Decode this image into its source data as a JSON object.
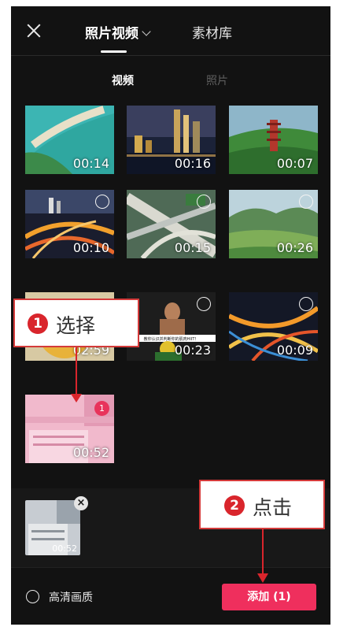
{
  "header": {
    "tab_photos_videos": "照片视频",
    "tab_library": "素材库"
  },
  "subtabs": {
    "video": "视频",
    "photo": "照片"
  },
  "grid": {
    "tiles": [
      {
        "duration": "00:14",
        "state": "none"
      },
      {
        "duration": "00:16",
        "state": "none"
      },
      {
        "duration": "00:07",
        "state": "none"
      },
      {
        "duration": "00:10",
        "state": "ring"
      },
      {
        "duration": "00:15",
        "state": "ring"
      },
      {
        "duration": "00:26",
        "state": "ring"
      },
      {
        "duration": "02:59",
        "state": "none"
      },
      {
        "duration": "00:23",
        "state": "ring"
      },
      {
        "duration": "00:09",
        "state": "ring"
      },
      {
        "duration": "00:52",
        "state": "selected",
        "badge": "1"
      }
    ],
    "fitness_caption": "教你认识并判断你的肌肉HIIT！"
  },
  "tray": {
    "selected_duration": "00:52",
    "remove_symbol": "×"
  },
  "footer": {
    "hq_label": "高清画质",
    "add_button": "添加 (1)"
  },
  "annotations": {
    "step1": {
      "number": "1",
      "label": "选择"
    },
    "step2": {
      "number": "2",
      "label": "点击"
    }
  },
  "colors": {
    "accent": "#ef2f5d",
    "annotation_red": "#d9252c",
    "background": "#121212"
  }
}
